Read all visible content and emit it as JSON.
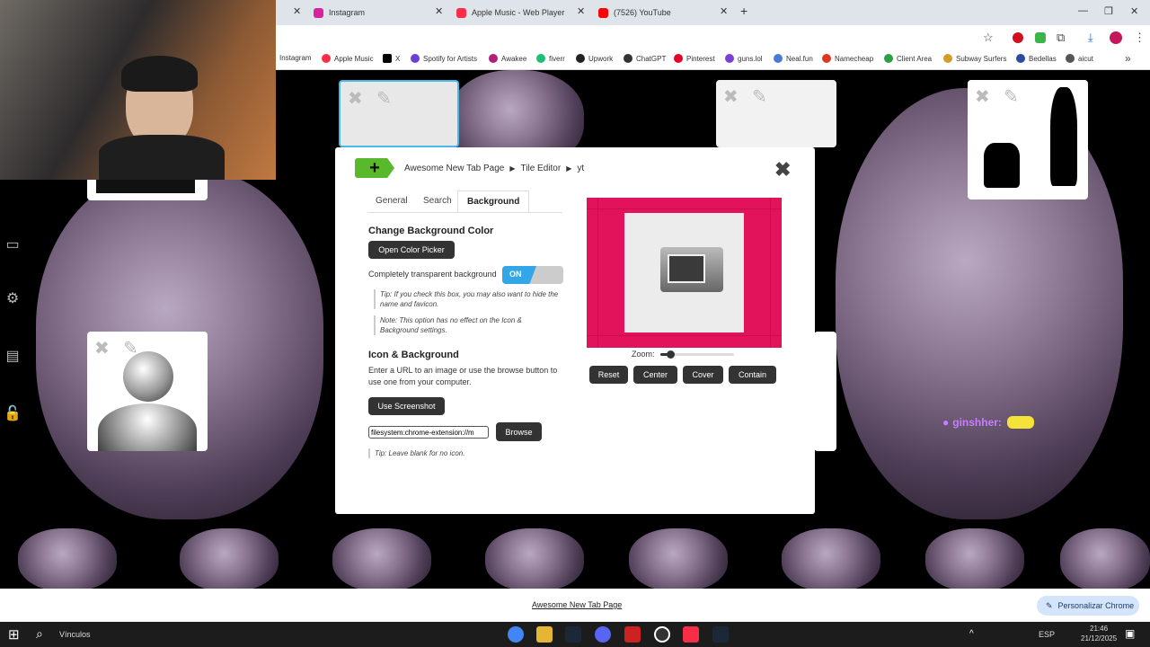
{
  "browser": {
    "tabs": [
      {
        "label": "Instagram",
        "color": "#d6249f"
      },
      {
        "label": "Apple Music - Web Player",
        "color": "#fa2d48"
      },
      {
        "label": "(7526) YouTube",
        "color": "#ff0000"
      }
    ],
    "bookmarks": [
      {
        "label": "Instagram",
        "color": "#d6249f"
      },
      {
        "label": "Apple Music",
        "color": "#fa2d48"
      },
      {
        "label": "X",
        "color": "#000000"
      },
      {
        "label": "Spotify for Artists",
        "color": "#6b3fd4"
      },
      {
        "label": "Awakee",
        "color": "#b0207a"
      },
      {
        "label": "fiverr",
        "color": "#1dbf73"
      },
      {
        "label": "Upwork",
        "color": "#222222"
      },
      {
        "label": "ChatGPT",
        "color": "#333333"
      },
      {
        "label": "Pinterest",
        "color": "#e60023"
      },
      {
        "label": "guns.lol",
        "color": "#7a3fd4"
      },
      {
        "label": "Neal.fun",
        "color": "#4a7bd4"
      },
      {
        "label": "Namecheap",
        "color": "#de3723"
      },
      {
        "label": "Client Area",
        "color": "#2c9f45"
      },
      {
        "label": "Subway Surfers",
        "color": "#d49a2a"
      },
      {
        "label": "Bedellas",
        "color": "#2c4aa0"
      },
      {
        "label": "aicut",
        "color": "#555555"
      }
    ],
    "footer_link": "Awesome New Tab Page",
    "customize_button": "Personalizar Chrome"
  },
  "modal": {
    "breadcrumb": [
      "Awesome New Tab Page",
      "Tile Editor",
      "yt"
    ],
    "tabs": [
      "General",
      "Search",
      "Background"
    ],
    "active_tab": "Background",
    "bg_heading": "Change Background Color",
    "color_picker_button": "Open Color Picker",
    "transparent_label": "Completely transparent background",
    "toggle_state": "ON",
    "tip1": "Tip: If you check this box, you may also want to hide the name and favicon.",
    "note1": "Note: This option has no effect on the Icon & Background settings.",
    "icon_heading": "Icon & Background",
    "icon_desc": "Enter a URL to an image or use the browse button to use one from your computer.",
    "screenshot_button": "Use Screenshot",
    "url_value": "filesystem:chrome-extension://m",
    "browse_button": "Browse",
    "tip2": "Tip: Leave blank for no icon.",
    "zoom_label": "Zoom:",
    "zoom_level": 0.1,
    "preview_bg": "#e2135a",
    "preview_buttons": [
      "Reset",
      "Center",
      "Cover",
      "Contain"
    ]
  },
  "chat": {
    "username": "ginshher:"
  },
  "taskbar": {
    "search_label": "Vínculos",
    "lang": "ESP",
    "time": "21:46",
    "date": "21/12/2025"
  }
}
